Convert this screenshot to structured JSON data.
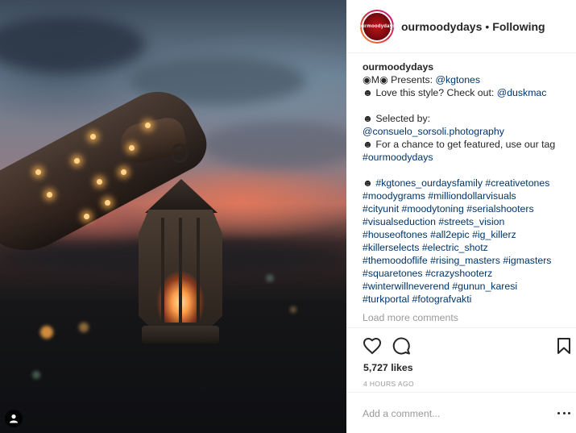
{
  "post": {
    "username": "ourmoodydays",
    "follow_status": "Following",
    "separator": "•",
    "avatar_text": "ourmoodydays"
  },
  "caption": {
    "author": "ourmoodydays",
    "lines": [
      [
        {
          "t": "◉M◉ Presents: "
        },
        {
          "t": "@kgtones",
          "link": true
        }
      ],
      [
        {
          "t": "☻ Love this style? Check out: "
        },
        {
          "t": "@duskmac",
          "link": true
        }
      ],
      [],
      [
        {
          "t": "☻ Selected by:"
        }
      ],
      [
        {
          "t": "@consuelo_sorsoli.photography",
          "link": true
        }
      ],
      [
        {
          "t": "☻ For a chance to get featured, use our tag"
        }
      ],
      [
        {
          "t": "#ourmoodydays",
          "link": true
        }
      ],
      [],
      [
        {
          "t": "☻ "
        },
        {
          "t": "#kgtones_ourdaysfamily",
          "link": true
        },
        {
          "t": " "
        },
        {
          "t": "#creativetones",
          "link": true
        }
      ],
      [
        {
          "t": "#moodygrams",
          "link": true
        },
        {
          "t": " "
        },
        {
          "t": "#milliondollarvisuals",
          "link": true
        }
      ],
      [
        {
          "t": "#cityunit",
          "link": true
        },
        {
          "t": " "
        },
        {
          "t": "#moodytoning",
          "link": true
        },
        {
          "t": " "
        },
        {
          "t": "#serialshooters",
          "link": true
        }
      ],
      [
        {
          "t": "#visualseduction",
          "link": true
        },
        {
          "t": " "
        },
        {
          "t": "#streets_vision",
          "link": true
        }
      ],
      [
        {
          "t": "#houseoftones",
          "link": true
        },
        {
          "t": " "
        },
        {
          "t": "#all2epic",
          "link": true
        },
        {
          "t": " "
        },
        {
          "t": "#ig_killerz",
          "link": true
        }
      ],
      [
        {
          "t": "#killerselects",
          "link": true
        },
        {
          "t": " "
        },
        {
          "t": "#electric_shotz",
          "link": true
        }
      ],
      [
        {
          "t": "#themoodoflife",
          "link": true
        },
        {
          "t": " "
        },
        {
          "t": "#rising_masters",
          "link": true
        },
        {
          "t": " "
        },
        {
          "t": "#igmasters",
          "link": true
        }
      ],
      [
        {
          "t": "#squaretones",
          "link": true
        },
        {
          "t": " "
        },
        {
          "t": "#crazyshooterz",
          "link": true
        }
      ],
      [
        {
          "t": "#winterwillneverend",
          "link": true
        },
        {
          "t": " "
        },
        {
          "t": "#gunun_karesi",
          "link": true
        }
      ],
      [
        {
          "t": "#turkportal",
          "link": true
        },
        {
          "t": " "
        },
        {
          "t": "#fotografvakti",
          "link": true
        }
      ]
    ]
  },
  "load_more_label": "Load more comments",
  "likes_label": "5,727 likes",
  "time_label": "4 HOURS AGO",
  "comment_box": {
    "placeholder": "Add a comment..."
  },
  "icons": {
    "like": "heart-icon",
    "comment": "comment-bubble-icon",
    "save": "bookmark-icon",
    "more": "more-options-icon",
    "user_tag": "user-tag-icon"
  },
  "colors": {
    "link": "#003569",
    "muted": "#999999",
    "text": "#262626",
    "divider": "#efefef"
  }
}
